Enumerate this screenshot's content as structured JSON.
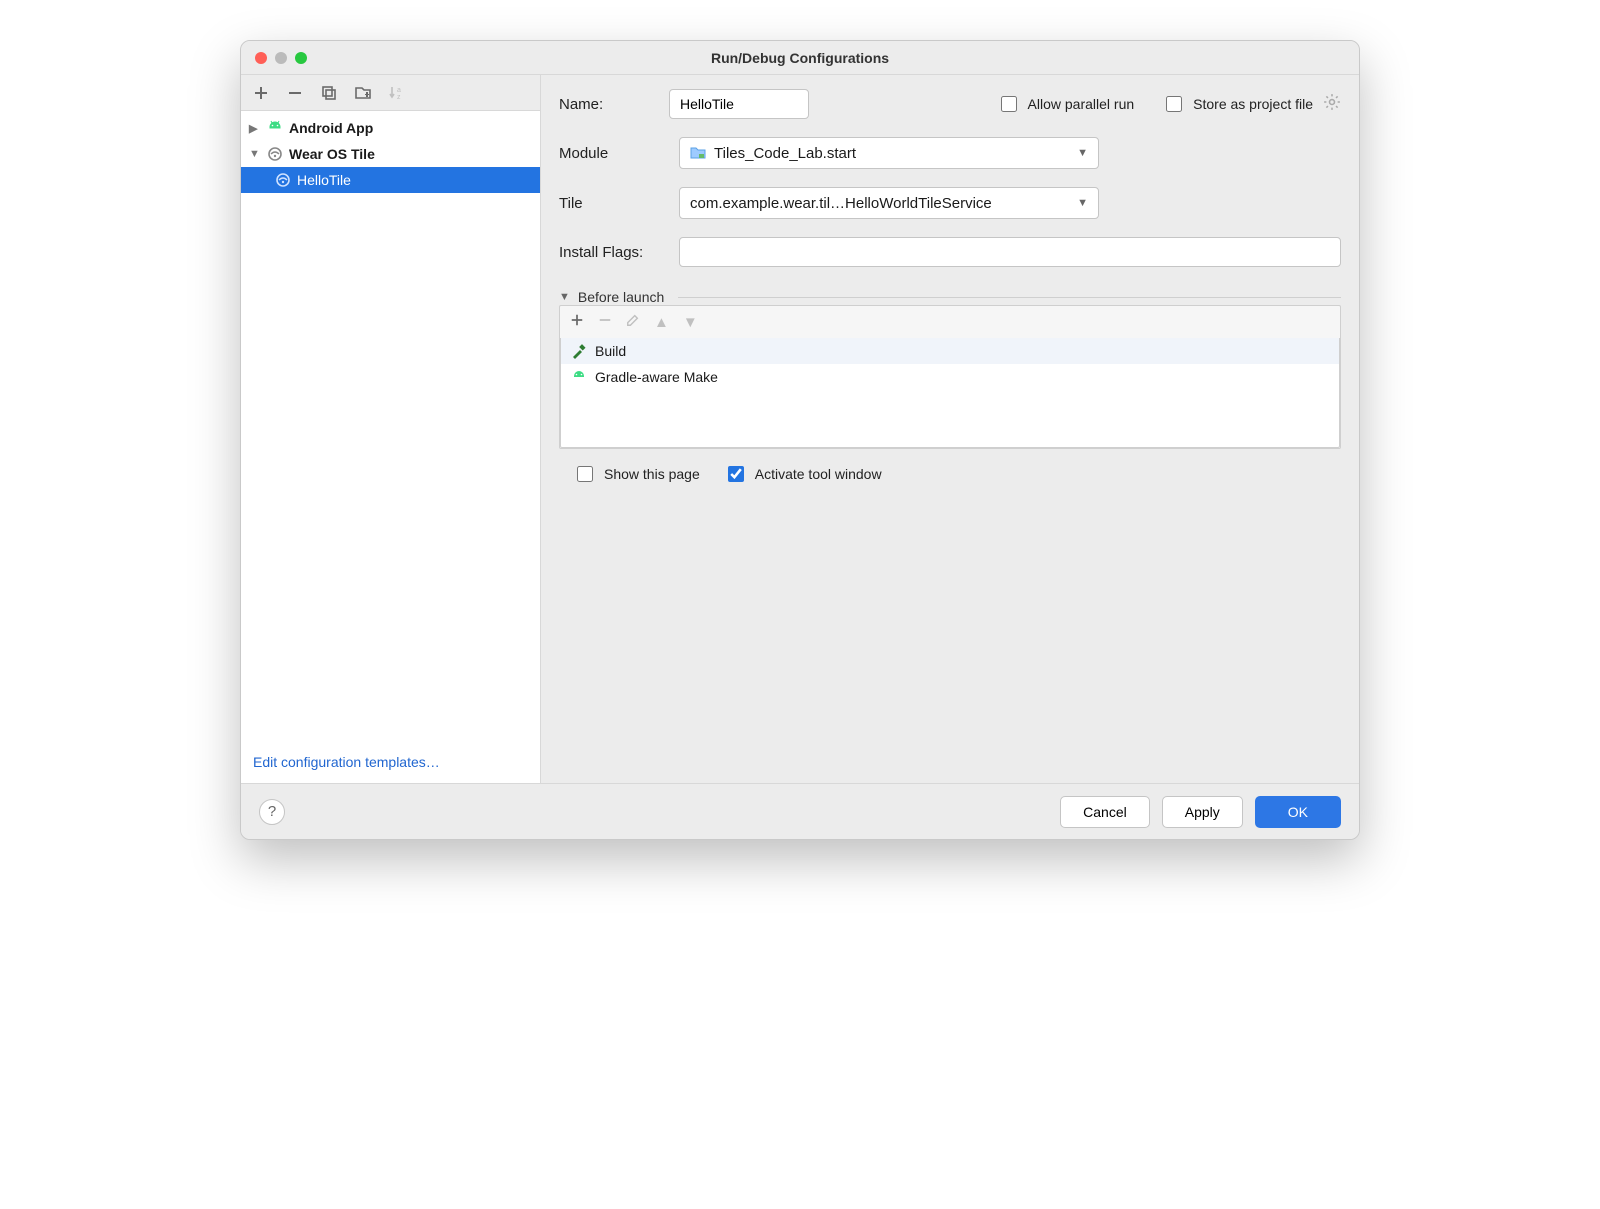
{
  "title": "Run/Debug Configurations",
  "tree": {
    "group1": "Android App",
    "group2": "Wear OS Tile",
    "item": "HelloTile"
  },
  "sidebar_footer": "Edit configuration templates…",
  "form": {
    "name_label": "Name:",
    "name_value": "HelloTile",
    "allow_parallel": "Allow parallel run",
    "store_project": "Store as project file",
    "module_label": "Module",
    "module_value": "Tiles_Code_Lab.start",
    "tile_label": "Tile",
    "tile_value": "com.example.wear.til…HelloWorldTileService",
    "install_label": "Install Flags:",
    "install_value": ""
  },
  "before_launch": {
    "header": "Before launch",
    "items": [
      "Build",
      "Gradle-aware Make"
    ],
    "show_page": "Show this page",
    "activate_tool": "Activate tool window"
  },
  "buttons": {
    "cancel": "Cancel",
    "apply": "Apply",
    "ok": "OK",
    "help": "?"
  }
}
